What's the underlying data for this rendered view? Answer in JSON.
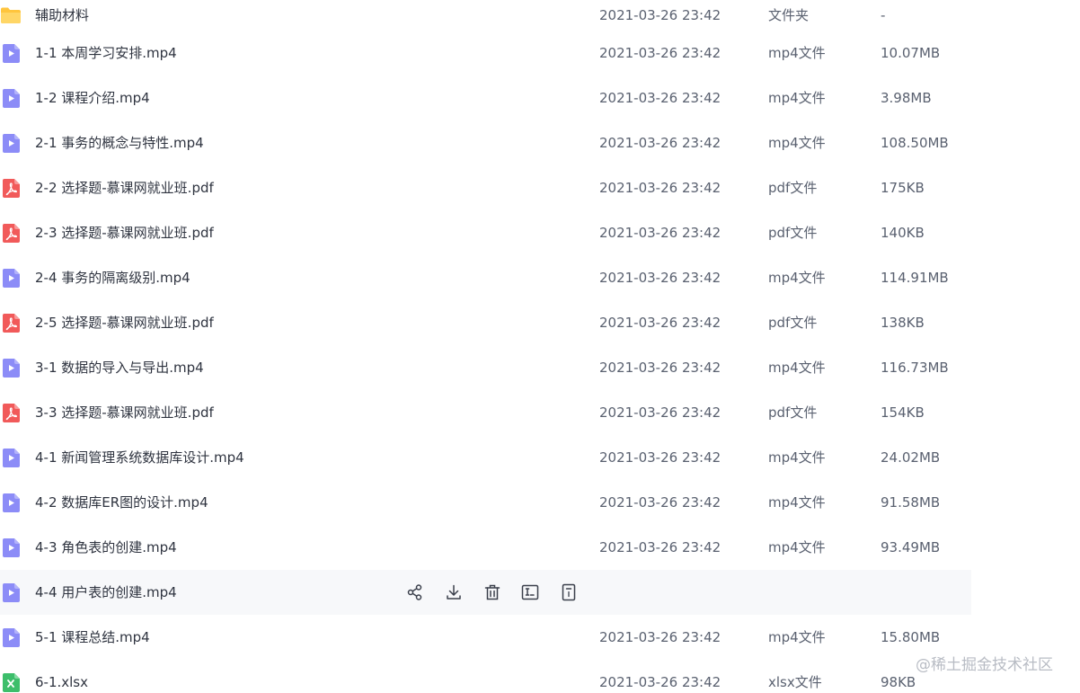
{
  "files": [
    {
      "name": "辅助材料",
      "date": "2021-03-26 23:42",
      "type": "文件夹",
      "size": "-",
      "icon": "folder-icon"
    },
    {
      "name": "1-1 本周学习安排.mp4",
      "date": "2021-03-26 23:42",
      "type": "mp4文件",
      "size": "10.07MB",
      "icon": "video-file-icon"
    },
    {
      "name": "1-2 课程介绍.mp4",
      "date": "2021-03-26 23:42",
      "type": "mp4文件",
      "size": "3.98MB",
      "icon": "video-file-icon"
    },
    {
      "name": "2-1 事务的概念与特性.mp4",
      "date": "2021-03-26 23:42",
      "type": "mp4文件",
      "size": "108.50MB",
      "icon": "video-file-icon"
    },
    {
      "name": "2-2 选择题-慕课网就业班.pdf",
      "date": "2021-03-26 23:42",
      "type": "pdf文件",
      "size": "175KB",
      "icon": "pdf-file-icon"
    },
    {
      "name": "2-3 选择题-慕课网就业班.pdf",
      "date": "2021-03-26 23:42",
      "type": "pdf文件",
      "size": "140KB",
      "icon": "pdf-file-icon"
    },
    {
      "name": "2-4 事务的隔离级别.mp4",
      "date": "2021-03-26 23:42",
      "type": "mp4文件",
      "size": "114.91MB",
      "icon": "video-file-icon"
    },
    {
      "name": "2-5 选择题-慕课网就业班.pdf",
      "date": "2021-03-26 23:42",
      "type": "pdf文件",
      "size": "138KB",
      "icon": "pdf-file-icon"
    },
    {
      "name": "3-1 数据的导入与导出.mp4",
      "date": "2021-03-26 23:42",
      "type": "mp4文件",
      "size": "116.73MB",
      "icon": "video-file-icon"
    },
    {
      "name": "3-3 选择题-慕课网就业班.pdf",
      "date": "2021-03-26 23:42",
      "type": "pdf文件",
      "size": "154KB",
      "icon": "pdf-file-icon"
    },
    {
      "name": "4-1 新闻管理系统数据库设计.mp4",
      "date": "2021-03-26 23:42",
      "type": "mp4文件",
      "size": "24.02MB",
      "icon": "video-file-icon"
    },
    {
      "name": "4-2 数据库ER图的设计.mp4",
      "date": "2021-03-26 23:42",
      "type": "mp4文件",
      "size": "91.58MB",
      "icon": "video-file-icon"
    },
    {
      "name": "4-3 角色表的创建.mp4",
      "date": "2021-03-26 23:42",
      "type": "mp4文件",
      "size": "93.49MB",
      "icon": "video-file-icon"
    },
    {
      "name": "4-4 用户表的创建.mp4",
      "date": "",
      "type": "",
      "size": "",
      "icon": "video-file-icon",
      "hovered": true
    },
    {
      "name": "5-1 课程总结.mp4",
      "date": "2021-03-26 23:42",
      "type": "mp4文件",
      "size": "15.80MB",
      "icon": "video-file-icon"
    },
    {
      "name": "6-1.xlsx",
      "date": "2021-03-26 23:42",
      "type": "xlsx文件",
      "size": "98KB",
      "icon": "excel-file-icon"
    }
  ],
  "row_actions": [
    {
      "icon": "share-icon"
    },
    {
      "icon": "download-icon"
    },
    {
      "icon": "delete-icon"
    },
    {
      "icon": "rename-icon"
    },
    {
      "icon": "more-icon"
    }
  ],
  "colors": {
    "folder": "#FFC53D",
    "video": "#8C8CF7",
    "pdf": "#F15A5A",
    "excel": "#3DBE6B",
    "hover_row": "#F7F8FA",
    "action_icon": "#3A3F4B"
  },
  "watermark": "@稀土掘金技术社区"
}
